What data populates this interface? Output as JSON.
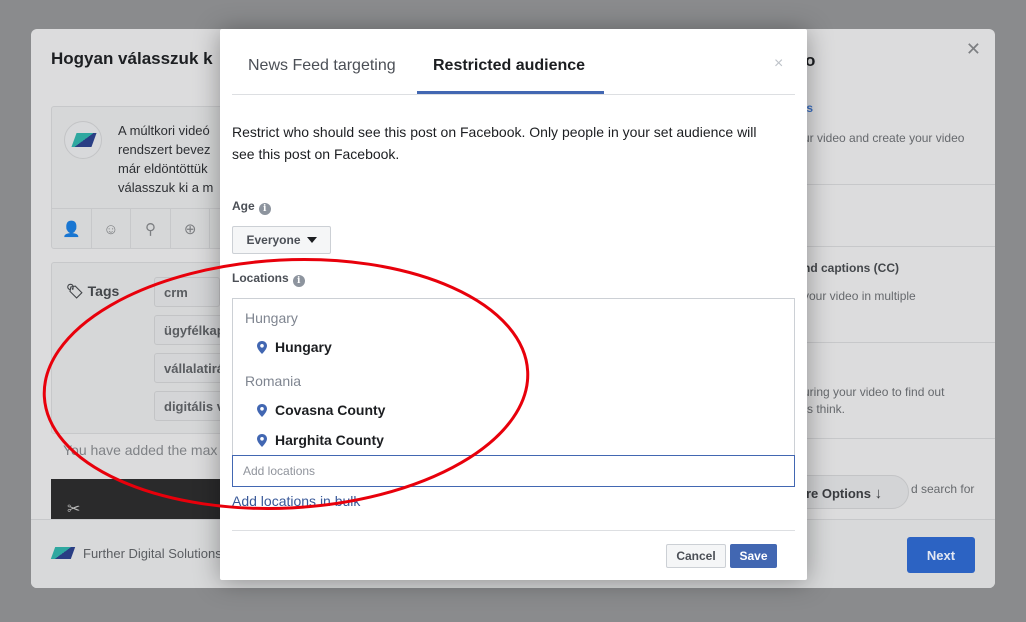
{
  "background": {
    "title": "Hogyan válasszuk k",
    "title_right": "o",
    "composer_text": "A múltkori videó\nrendszert bevez\nmár eldöntöttük\nválasszuk ki a m",
    "tags_label": "Tags",
    "tags": [
      "crm",
      "ügyfélkap",
      "vállalatirá",
      "digitális v"
    ],
    "max_note": "You have added the max",
    "footer_name": "Further Digital Solutions",
    "next_label": "Next",
    "right_panel": {
      "link": "ls",
      "line1": "ur video and create your video",
      "captions_heading": "nd captions (CC)",
      "captions_text": "your video in multiple",
      "survey_text_1": "uring your video to find out",
      "survey_text_2": "rs think.",
      "more_options": "ore Options",
      "more_after": "d search for"
    }
  },
  "dialog": {
    "tabs": [
      {
        "label": "News Feed targeting",
        "active": false
      },
      {
        "label": "Restricted audience",
        "active": true
      }
    ],
    "close_symbol": "×",
    "description": "Restrict who should see this post on Facebook. Only people in your set audience will see this post on Facebook.",
    "age": {
      "label": "Age",
      "value": "Everyone"
    },
    "locations": {
      "label": "Locations",
      "groups": [
        {
          "country": "Hungary",
          "items": [
            "Hungary"
          ]
        },
        {
          "country": "Romania",
          "items": [
            "Covasna County",
            "Harghita County"
          ]
        }
      ],
      "input_placeholder": "Add locations",
      "bulk_link": "Add locations in bulk"
    },
    "buttons": {
      "cancel": "Cancel",
      "save": "Save"
    }
  },
  "colors": {
    "accent": "#4267b2",
    "annotation": "#e8000b"
  },
  "icons": [
    "close-icon",
    "info-icon",
    "caret-down-icon",
    "location-pin-icon",
    "tag-icon",
    "tag-person-icon",
    "emoji-icon",
    "location-icon",
    "target-icon",
    "scissors-icon",
    "arrow-down-icon"
  ]
}
